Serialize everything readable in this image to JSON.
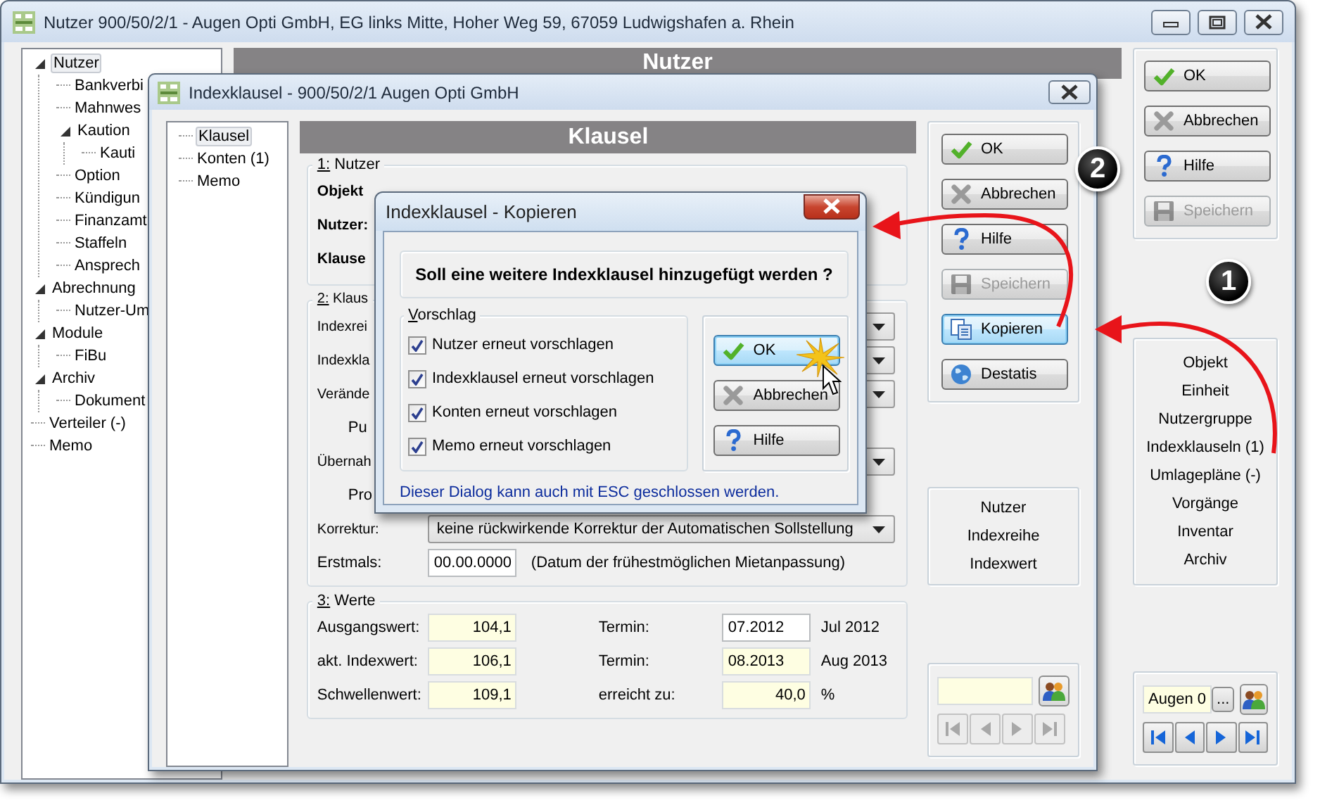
{
  "main_window": {
    "title": "Nutzer 900/50/2/1 - Augen Opti GmbH, EG links Mitte, Hoher Weg 59, 67059 Ludwigshafen a. Rhein",
    "tree": [
      {
        "label": "Nutzer",
        "selected": true,
        "expanded": true,
        "children": [
          {
            "label": "Bankverbi",
            "selected": false
          },
          {
            "label": "Mahnwes",
            "selected": false
          },
          {
            "label": "Kaution",
            "selected": false,
            "expanded": true,
            "children": [
              {
                "label": "Kauti",
                "selected": false
              }
            ]
          },
          {
            "label": "Option",
            "selected": false
          },
          {
            "label": "Kündigun",
            "selected": false
          },
          {
            "label": "Finanzamt",
            "selected": false
          },
          {
            "label": "Staffeln",
            "selected": false
          },
          {
            "label": "Ansprech",
            "selected": false
          }
        ]
      },
      {
        "label": "Abrechnung",
        "selected": false,
        "expanded": true,
        "children": [
          {
            "label": "Nutzer-Um",
            "selected": false
          }
        ]
      },
      {
        "label": "Module",
        "selected": false,
        "expanded": true,
        "children": [
          {
            "label": "FiBu",
            "selected": false
          }
        ]
      },
      {
        "label": "Archiv",
        "selected": false,
        "expanded": true,
        "children": [
          {
            "label": "Dokument",
            "selected": false
          }
        ]
      },
      {
        "label": "Verteiler (-)",
        "selected": false
      },
      {
        "label": "Memo",
        "selected": false
      }
    ],
    "header": "Nutzer",
    "buttons": [
      {
        "label": "OK",
        "kind": "check",
        "disabled": false,
        "focused": false
      },
      {
        "label": "Abbrechen",
        "kind": "cross",
        "disabled": false,
        "focused": false
      },
      {
        "label": "Hilfe",
        "kind": "help",
        "disabled": false,
        "focused": false
      },
      {
        "label": "Speichern",
        "kind": "save",
        "disabled": true,
        "focused": false
      }
    ],
    "links": [
      "Objekt",
      "Einheit",
      "Nutzergruppe",
      "Indexklauseln (1)",
      "Umlagepläne (-)",
      "Vorgänge",
      "Inventar",
      "Archiv"
    ],
    "navigator": {
      "value": "Augen 0",
      "browse": "...",
      "disabled": false
    }
  },
  "index_window": {
    "title": "Indexklausel - 900/50/2/1 Augen Opti GmbH",
    "tree": [
      {
        "label": "Klausel",
        "selected": true
      },
      {
        "label": "Konten (1)",
        "selected": false
      },
      {
        "label": "Memo",
        "selected": false
      }
    ],
    "header": "Klausel",
    "group_1": {
      "legend": "1: Nutzer",
      "labels": [
        "Objekt",
        "Nutzer:",
        "Klause"
      ]
    },
    "group_2": {
      "legend": "2: Klaus",
      "rows": [
        {
          "label": "Indexrei",
          "kind": "combo"
        },
        {
          "label": "Indexkla",
          "kind": "combo"
        },
        {
          "label": "Verände",
          "kind": "combo"
        },
        {
          "label": "Pu",
          "kind": "sublabel"
        },
        {
          "label": "Übernah",
          "kind": "combo"
        },
        {
          "label": "Pro",
          "kind": "sublabel"
        },
        {
          "label": "Korrektur:",
          "kind": "combo",
          "value": "keine rückwirkende Korrektur der Automatischen Sollstellung"
        },
        {
          "label": "Erstmals:",
          "kind": "date",
          "value": "00.00.0000",
          "note": "(Datum der frühestmöglichen Mietanpassung)"
        }
      ]
    },
    "group_3": {
      "legend": "3: Werte",
      "rows": [
        {
          "kind": "date",
          "label": "Ausgangswert:",
          "value": "104,1",
          "label_2": "Termin:",
          "value_2": "07.2012",
          "readonly_2": false,
          "suffix": "Jul 2012"
        },
        {
          "kind": "date",
          "label": "akt. Indexwert:",
          "value": "106,1",
          "label_2": "Termin:",
          "value_2": "08.2013",
          "readonly_2": true,
          "suffix": "Aug 2013"
        },
        {
          "kind": "percent",
          "label": "Schwellenwert:",
          "value": "109,1",
          "label_2": "erreicht zu:",
          "value_2": "40,0",
          "readonly_2": true,
          "suffix": "%"
        }
      ]
    },
    "buttons": [
      {
        "label": "OK",
        "kind": "check",
        "disabled": false,
        "focused": false
      },
      {
        "label": "Abbrechen",
        "kind": "cross",
        "disabled": false,
        "focused": false
      },
      {
        "label": "Hilfe",
        "kind": "help",
        "disabled": false,
        "focused": false
      },
      {
        "label": "Speichern",
        "kind": "save",
        "disabled": true,
        "focused": false
      },
      {
        "label": "Kopieren",
        "kind": "copy",
        "disabled": false,
        "focused": true
      },
      {
        "label": "Destatis",
        "kind": "globe",
        "disabled": false,
        "focused": false
      }
    ],
    "links": [
      "Nutzer",
      "Indexreihe",
      "Indexwert"
    ],
    "navigator": {
      "disabled": true
    }
  },
  "dialog": {
    "title": "Indexklausel - Kopieren",
    "question": "Soll eine weitere Indexklausel hinzugefügt werden ?",
    "legend": "Vorschlag",
    "options": [
      {
        "label": "Nutzer erneut vorschlagen",
        "checked": true
      },
      {
        "label": "Indexklausel erneut vorschlagen",
        "checked": true
      },
      {
        "label": "Konten erneut vorschlagen",
        "checked": true
      },
      {
        "label": "Memo erneut vorschlagen",
        "checked": true
      }
    ],
    "buttons": [
      {
        "label": "OK",
        "kind": "check",
        "disabled": false,
        "focused": true
      },
      {
        "label": "Abbrechen",
        "kind": "cross",
        "disabled": false,
        "focused": false
      },
      {
        "label": "Hilfe",
        "kind": "help",
        "disabled": false,
        "focused": false
      }
    ],
    "footer": "Dieser Dialog kann auch mit ESC geschlossen werden."
  },
  "annotations": [
    {
      "label": "1"
    },
    {
      "label": "2"
    }
  ]
}
